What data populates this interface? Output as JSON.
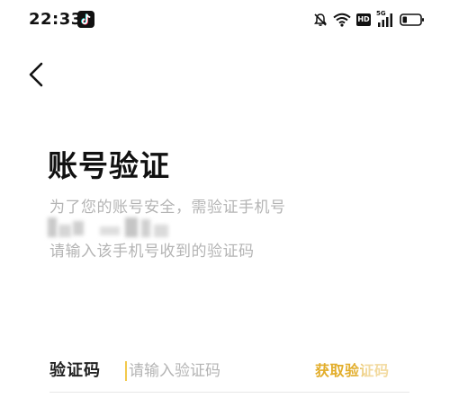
{
  "status_bar": {
    "time": "22:33",
    "hd": "HD",
    "network": "5G",
    "icons": [
      "tiktok-icon",
      "mute-bell-icon",
      "wifi-icon",
      "hd-icon",
      "signal-icon",
      "battery-icon"
    ]
  },
  "nav": {
    "back_icon": "chevron-left-icon"
  },
  "content": {
    "title": "账号验证",
    "hint_line_1": "为了您的账号安全，需验证手机号",
    "hint_line_3": "请输入该手机号收到的验证码"
  },
  "code_row": {
    "label": "验证码",
    "placeholder": "请输入验证码",
    "get_code": "获取验证码"
  },
  "colors": {
    "accent": "#e2ad2a",
    "cursor": "#f2c94c",
    "hint_text": "#b4b4b4",
    "title_text": "#111111"
  }
}
